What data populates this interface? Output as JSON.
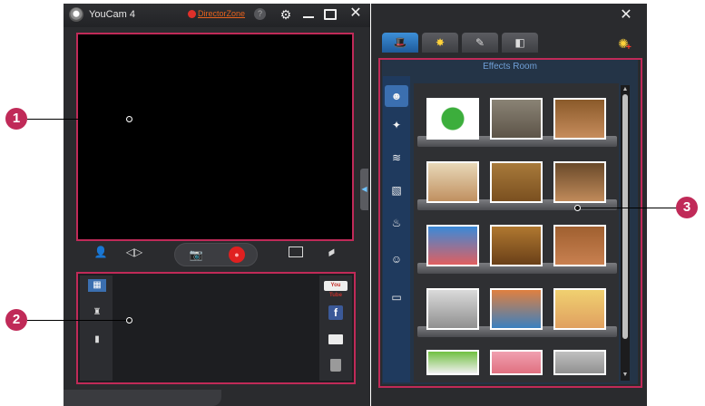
{
  "main_window": {
    "title": "YouCam 4",
    "director_zone": "DirectorZone",
    "help": "?",
    "settings_icon": "gear-icon",
    "minimize_icon": "minimize-icon",
    "fullscreen_icon": "fullscreen-icon",
    "close_icon": "close-icon"
  },
  "capture_controls": {
    "left": [
      "face-tracking-icon",
      "mirror-icon"
    ],
    "center": [
      "camera-icon",
      "record-icon"
    ],
    "right": [
      "screen-icon",
      "eraser-icon"
    ]
  },
  "library": {
    "left_icons": [
      "view-toggle-icon",
      "sort-icon",
      "filmstrip-icon"
    ],
    "right_buttons": {
      "youtube": "You Tube",
      "facebook": "f",
      "email_icon": "envelope-icon",
      "delete_icon": "trash-icon"
    }
  },
  "effects_window": {
    "close_icon": "close-icon",
    "tabs": [
      {
        "icon": "effects-room-icon",
        "active": true
      },
      {
        "icon": "sparkle-icon",
        "active": false
      },
      {
        "icon": "brush-icon",
        "active": false
      },
      {
        "icon": "camera-icon",
        "active": false
      }
    ],
    "add_effect_icon": "add-effect-icon",
    "room_title": "Effects Room",
    "categories": [
      {
        "icon": "avatar-icon",
        "active": true
      },
      {
        "icon": "magic-wand-icon",
        "active": false
      },
      {
        "icon": "wind-icon",
        "active": false
      },
      {
        "icon": "frame-icon",
        "active": false
      },
      {
        "icon": "distortion-icon",
        "active": false
      },
      {
        "icon": "emotion-icon",
        "active": false
      },
      {
        "icon": "scene-icon",
        "active": false
      }
    ],
    "effects": [
      {
        "row": 1,
        "items": [
          "download-globe",
          "statue-face",
          "woman-with-hat"
        ]
      },
      {
        "row": 2,
        "items": [
          "cartoon-man",
          "teddy-bear",
          "cartoon-boy"
        ]
      },
      {
        "row": 3,
        "items": [
          "clown",
          "dog",
          "poodle"
        ]
      },
      {
        "row": 4,
        "items": [
          "bust-statue",
          "lion",
          "cartoon-girl"
        ]
      },
      {
        "row": 5,
        "items": [
          "green-creature",
          "pink-pig",
          "gray-animal"
        ]
      }
    ]
  },
  "callouts": [
    "1",
    "2",
    "3"
  ],
  "colors": {
    "accent": "#c02a58",
    "selected_tab": "#3d8fd8",
    "record": "#e02020",
    "effects_room_title": "#6f9fd6"
  }
}
